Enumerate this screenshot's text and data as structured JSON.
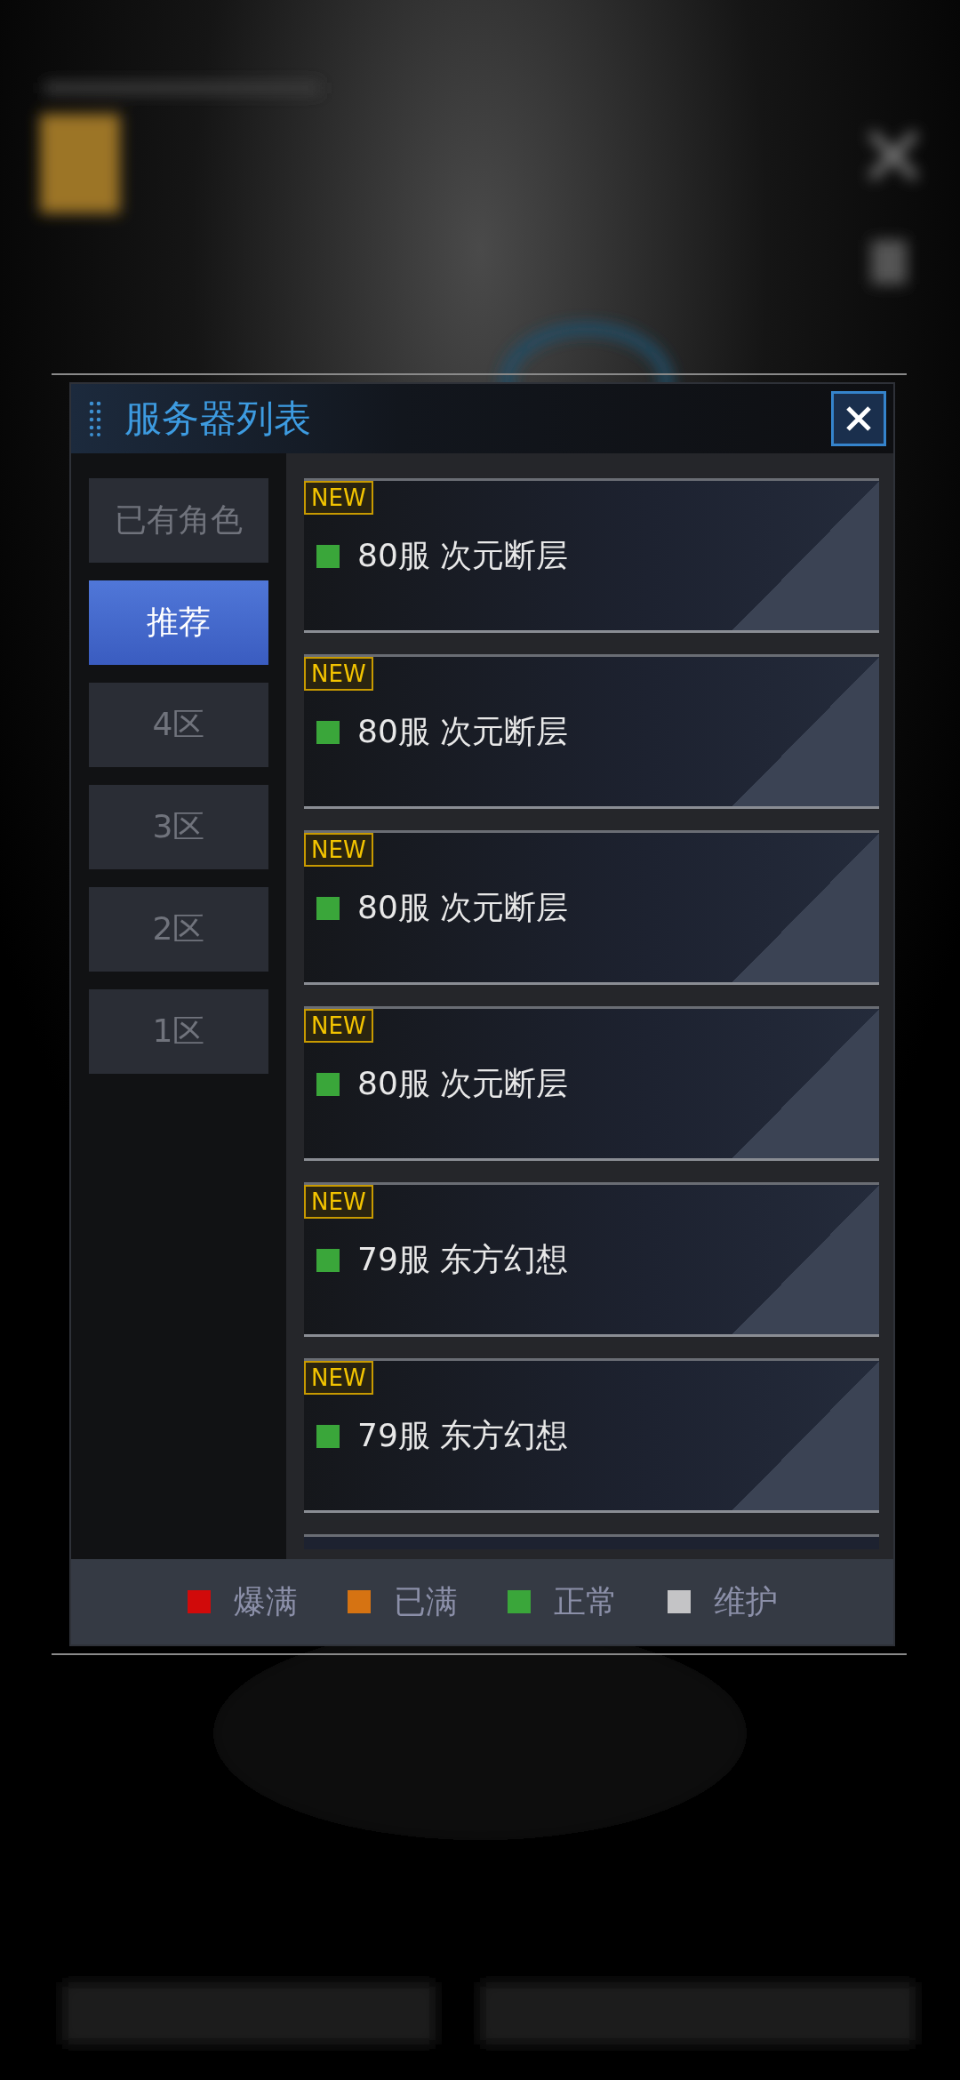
{
  "dialog": {
    "title": "服务器列表"
  },
  "tabs": [
    {
      "label": "已有角色",
      "selected": false
    },
    {
      "label": "推荐",
      "selected": true
    },
    {
      "label": "4区",
      "selected": false
    },
    {
      "label": "3区",
      "selected": false
    },
    {
      "label": "2区",
      "selected": false
    },
    {
      "label": "1区",
      "selected": false
    }
  ],
  "servers": [
    {
      "badge": "NEW",
      "name": "80服 次元断层",
      "color": "#3aa63a"
    },
    {
      "badge": "NEW",
      "name": "80服 次元断层",
      "color": "#3aa63a"
    },
    {
      "badge": "NEW",
      "name": "80服 次元断层",
      "color": "#3aa63a"
    },
    {
      "badge": "NEW",
      "name": "80服 次元断层",
      "color": "#3aa63a"
    },
    {
      "badge": "NEW",
      "name": "79服 东方幻想",
      "color": "#3aa63a"
    },
    {
      "badge": "NEW",
      "name": "79服 东方幻想",
      "color": "#3aa63a"
    }
  ],
  "legend": [
    {
      "label": "爆满",
      "color": "#d10a0a"
    },
    {
      "label": "已满",
      "color": "#d67312"
    },
    {
      "label": "正常",
      "color": "#3aa63a"
    },
    {
      "label": "维护",
      "color": "#c4c4c6"
    }
  ]
}
